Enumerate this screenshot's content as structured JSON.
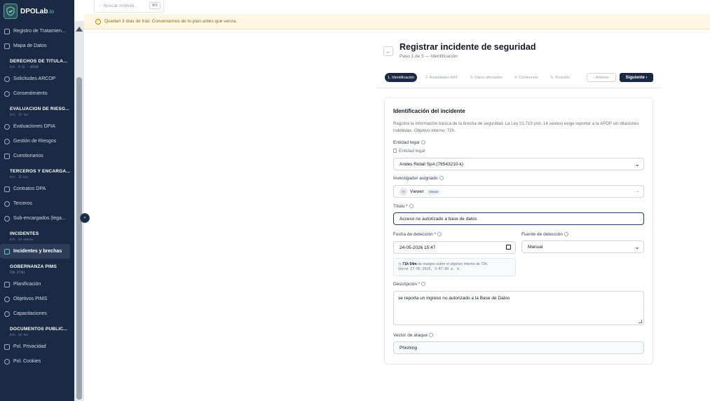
{
  "brand": {
    "name": "DPOLab",
    "suffix": ".io"
  },
  "sidebar": {
    "collapse_glyph": "«",
    "top_items": [
      {
        "label": "Registro de Tratamien..."
      },
      {
        "label": "Mapa de Datos"
      }
    ],
    "sections": [
      {
        "title": "DERECHOS DE TITULA...",
        "sub": "Art. 4-11 · ARCOP",
        "items": [
          {
            "label": "Solicitudes ARCOP"
          },
          {
            "label": "Consentimiento"
          }
        ]
      },
      {
        "title": "EVALUACIÓN DE RIESG...",
        "sub": "Art. 15 ter",
        "items": [
          {
            "label": "Evaluaciones DPIA"
          },
          {
            "label": "Gestión de Riesgos"
          },
          {
            "label": "Cuestionarios"
          }
        ]
      },
      {
        "title": "TERCEROS Y ENCARGA...",
        "sub": "Art. 15 bis",
        "items": [
          {
            "label": "Contratos DPA"
          },
          {
            "label": "Terceros"
          },
          {
            "label": "Sub-encargados (lega..."
          }
        ]
      },
      {
        "title": "INCIDENTES",
        "sub": "Art. 14 sexies",
        "items": [
          {
            "label": "Incidentes y brechas",
            "active": true
          }
        ]
      },
      {
        "title": "GOBERNANZA PIMS",
        "sub": "ISO 27701",
        "items": [
          {
            "label": "Planificación"
          },
          {
            "label": "Objetivos PIMS"
          },
          {
            "label": "Capacitaciones"
          }
        ]
      },
      {
        "title": "DOCUMENTOS PÚBLIC...",
        "sub": "Art. 14 ter",
        "items": [
          {
            "label": "Pol. Privacidad"
          },
          {
            "label": "Pol. Cookies"
          }
        ]
      }
    ]
  },
  "search": {
    "placeholder": "Buscar módulo...",
    "shortcut": "⌘K"
  },
  "trial": {
    "icon": "!",
    "text": "Quedan 3 días de trial. Conversemos de tu plan antes que venza."
  },
  "page": {
    "back_glyph": "←",
    "title": "Registrar incidente de seguridad",
    "subtitle": "Paso 1 de 5 — Identificación"
  },
  "stepper": {
    "steps": [
      {
        "label": "1. Identificación",
        "active": true
      },
      {
        "label": "2. Actividades RAT"
      },
      {
        "label": "3. Datos afectados"
      },
      {
        "label": "4. Contención"
      },
      {
        "label": "5. Revisión"
      }
    ],
    "prev_label": "‹ Anterior",
    "next_label": "Siguiente ›"
  },
  "form": {
    "title": "Identificación del incidente",
    "description": "Registra la información básica de la brecha de seguridad. La Ley 21.719 (Art. 14 sexies) exige reportar a la APDP sin dilaciones indebidas. Objetivo interno: 72h.",
    "entity": {
      "label": "Entidad legal",
      "sublabel": "Entidad legal",
      "value": "Andes Retail SpA (76543210-k)"
    },
    "investigator": {
      "label": "Investigador asignado",
      "avatar": "VI",
      "value": "Viewer",
      "badge": "Viewer"
    },
    "title_field": {
      "label": "Título *",
      "value": "Acceso no autorizado a base de datos"
    },
    "detection_date": {
      "label": "Fecha de detección *",
      "value": "24-05-2026 15:47"
    },
    "detection_source": {
      "label": "Fuente de detección",
      "value": "Manual"
    },
    "hint": {
      "strong": "71h 54m",
      "text": " de margen sobre el objetivo interno de 72h.",
      "line2": "Vence 27-05-2026, 3:47:00 p. m."
    },
    "description_field": {
      "label": "Descripción *",
      "value": "se reporta un ingreso no autorizado a la Base de Datos"
    },
    "vector": {
      "label": "Vector de ataque",
      "value": "Phishing"
    }
  }
}
